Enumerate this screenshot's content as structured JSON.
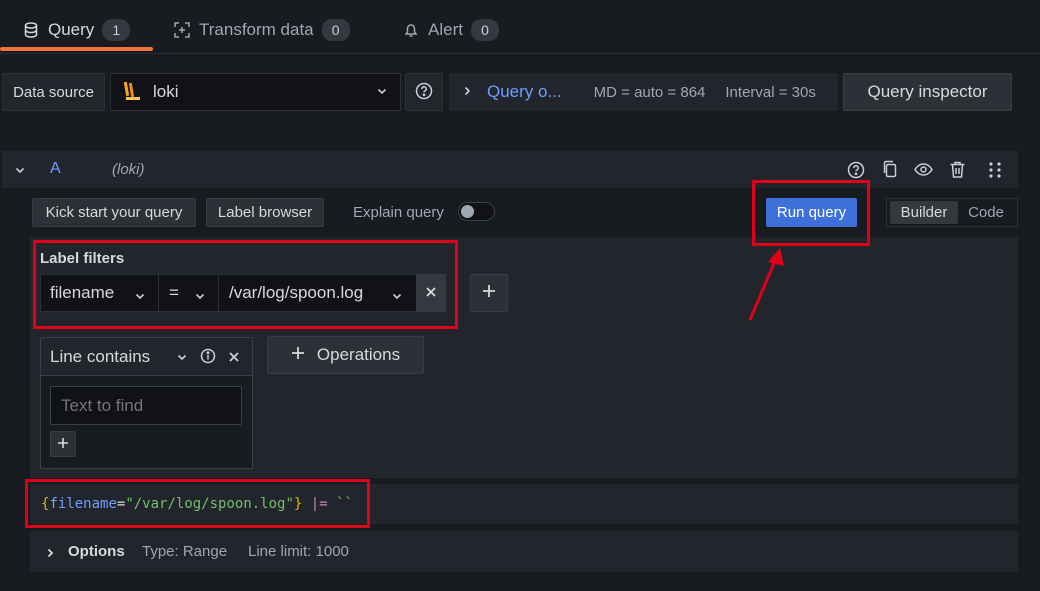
{
  "tabs": [
    {
      "label": "Query",
      "count": "1"
    },
    {
      "label": "Transform data",
      "count": "0"
    },
    {
      "label": "Alert",
      "count": "0"
    }
  ],
  "datasource": {
    "label": "Data source",
    "selected": "loki"
  },
  "query_options": {
    "label": "Query o...",
    "md": "MD = auto = 864",
    "interval": "Interval = 30s",
    "inspector_label": "Query inspector"
  },
  "query_row": {
    "ref_id": "A",
    "datasource_hint": "(loki)"
  },
  "toolbar": {
    "kick_start": "Kick start your query",
    "label_browser": "Label browser",
    "explain": "Explain query",
    "run_query": "Run query",
    "builder": "Builder",
    "code": "Code"
  },
  "label_filters": {
    "title": "Label filters",
    "label": "filename",
    "operator": "=",
    "value": "/var/log/spoon.log"
  },
  "operation": {
    "title": "Line contains",
    "placeholder": "Text to find",
    "add_operations": "Operations"
  },
  "query_preview": {
    "open_brace": "{",
    "key": "filename",
    "eq": "=",
    "value": "\"/var/log/spoon.log\"",
    "close_brace": "}",
    "pipe": "|=",
    "literal": "``"
  },
  "options": {
    "title": "Options",
    "type": "Type: Range",
    "line_limit": "Line limit: 1000"
  },
  "colors": {
    "accent_blue": "#3d71d9",
    "tab_underline": "#f3733e",
    "annotation_red": "#e1001a"
  }
}
